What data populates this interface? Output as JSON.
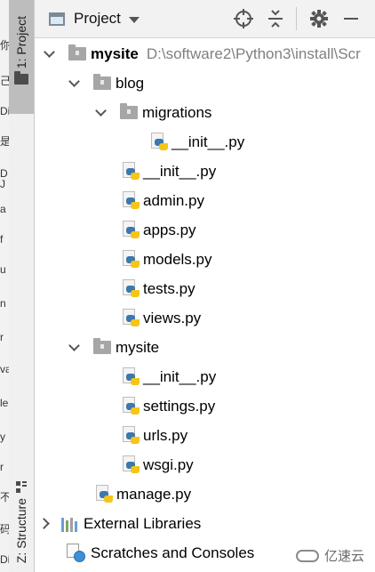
{
  "stripe": {
    "project_tab": "1: Project",
    "structure_tab": "Z: Structure"
  },
  "background_chars": [
    "你",
    "己",
    "Di",
    "是",
    "D",
    "J",
    "a",
    "f",
    "u",
    "n",
    "r",
    "va",
    "le",
    "y",
    "r",
    "不",
    "码",
    "Di"
  ],
  "header": {
    "title": "Project"
  },
  "tree": {
    "root_name": "mysite",
    "root_path": "D:\\software2\\Python3\\install\\Scr",
    "items": [
      {
        "label": "blog"
      },
      {
        "label": "migrations"
      },
      {
        "label": "__init__.py"
      },
      {
        "label": "__init__.py"
      },
      {
        "label": "admin.py"
      },
      {
        "label": "apps.py"
      },
      {
        "label": "models.py"
      },
      {
        "label": "tests.py"
      },
      {
        "label": "views.py"
      },
      {
        "label": "mysite"
      },
      {
        "label": "__init__.py"
      },
      {
        "label": "settings.py"
      },
      {
        "label": "urls.py"
      },
      {
        "label": "wsgi.py"
      },
      {
        "label": "manage.py"
      },
      {
        "label": "External Libraries"
      },
      {
        "label": "Scratches and Consoles"
      }
    ]
  },
  "watermark": "亿速云"
}
